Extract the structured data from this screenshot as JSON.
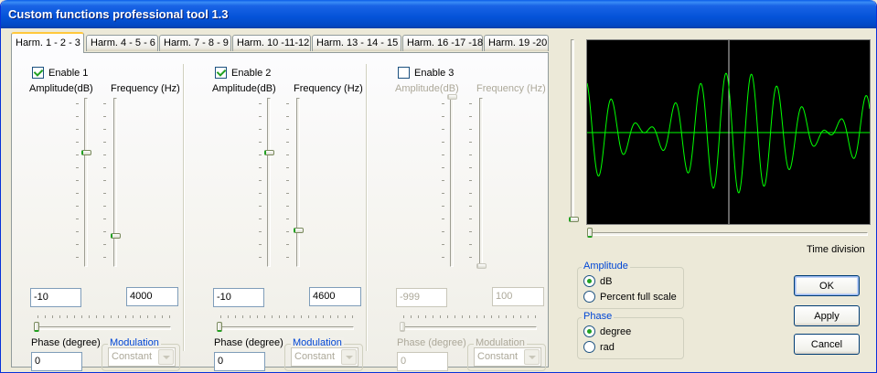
{
  "window": {
    "title": "Custom functions professional tool 1.3"
  },
  "tabs": [
    {
      "label": "Harm. 1 - 2 - 3",
      "active": true
    },
    {
      "label": "Harm. 4 - 5 - 6"
    },
    {
      "label": "Harm. 7 - 8 - 9"
    },
    {
      "label": "Harm. 10 -11-12"
    },
    {
      "label": "Harm. 13 - 14 - 15"
    },
    {
      "label": "Harm. 16 -17 -18"
    },
    {
      "label": "Harm. 19 -20"
    }
  ],
  "harmonics": [
    {
      "enable_label": "Enable 1",
      "enabled": true,
      "amplitude_label": "Amplitude(dB)",
      "frequency_label": "Frequency (Hz)",
      "amplitude_value": "-10",
      "frequency_value": "4000",
      "phase_label": "Phase (degree)",
      "phase_value": "0",
      "modulation_label": "Modulation",
      "modulation_value": "Constant",
      "amp_level": 0.33,
      "freq_level": 0.82,
      "phase_level": 0.0
    },
    {
      "enable_label": "Enable 2",
      "enabled": true,
      "amplitude_label": "Amplitude(dB)",
      "frequency_label": "Frequency (Hz)",
      "amplitude_value": "-10",
      "frequency_value": "4600",
      "phase_label": "Phase (degree)",
      "phase_value": "0",
      "modulation_label": "Modulation",
      "modulation_value": "Constant",
      "amp_level": 0.33,
      "freq_level": 0.79,
      "phase_level": 0.0
    },
    {
      "enable_label": "Enable 3",
      "enabled": false,
      "amplitude_label": "Amplitude(dB)",
      "frequency_label": "Frequency (Hz)",
      "amplitude_value": "-999",
      "frequency_value": "100",
      "phase_label": "Phase (degree)",
      "phase_value": "0",
      "modulation_label": "Modulation",
      "modulation_value": "Constant",
      "amp_level": 0.0,
      "freq_level": 1.0,
      "phase_level": 0.0
    }
  ],
  "scope": {
    "time_division_label": "Time division",
    "trace_color": "#00ff00",
    "background": "#000000"
  },
  "amplitude_group": {
    "legend": "Amplitude",
    "options": [
      "dB",
      "Percent full scale"
    ],
    "selected": 0
  },
  "phase_group": {
    "legend": "Phase",
    "options": [
      "degree",
      "rad"
    ],
    "selected": 0
  },
  "buttons": {
    "ok": "OK",
    "apply": "Apply",
    "cancel": "Cancel"
  }
}
